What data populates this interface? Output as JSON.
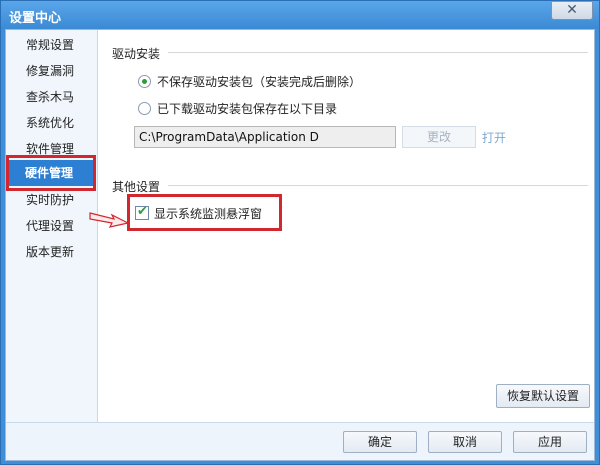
{
  "window": {
    "title": "设置中心",
    "close_glyph": "✕"
  },
  "sidebar": {
    "items": [
      {
        "label": "常规设置"
      },
      {
        "label": "修复漏洞"
      },
      {
        "label": "查杀木马"
      },
      {
        "label": "系统优化"
      },
      {
        "label": "软件管理"
      },
      {
        "label": "硬件管理",
        "active": true
      },
      {
        "label": "实时防护"
      },
      {
        "label": "代理设置"
      },
      {
        "label": "版本更新"
      }
    ]
  },
  "driver_install": {
    "group_title": "驱动安装",
    "option_no_keep": "不保存驱动安装包（安装完成后删除）",
    "option_keep": "已下载驱动安装包保存在以下目录",
    "selected": "no_keep",
    "path_value": "C:\\ProgramData\\Application D",
    "change_label": "更改",
    "open_label": "打开"
  },
  "other_settings": {
    "group_title": "其他设置",
    "show_monitor_label": "显示系统监测悬浮窗",
    "show_monitor_checked": true
  },
  "buttons": {
    "restore_defaults": "恢复默认设置",
    "ok": "确定",
    "cancel": "取消",
    "apply": "应用"
  },
  "colors": {
    "title_bar": "#3b8ad4",
    "active_nav": "#2d7fd3",
    "highlight": "#d0282e",
    "check_green": "#2e9e3a"
  }
}
